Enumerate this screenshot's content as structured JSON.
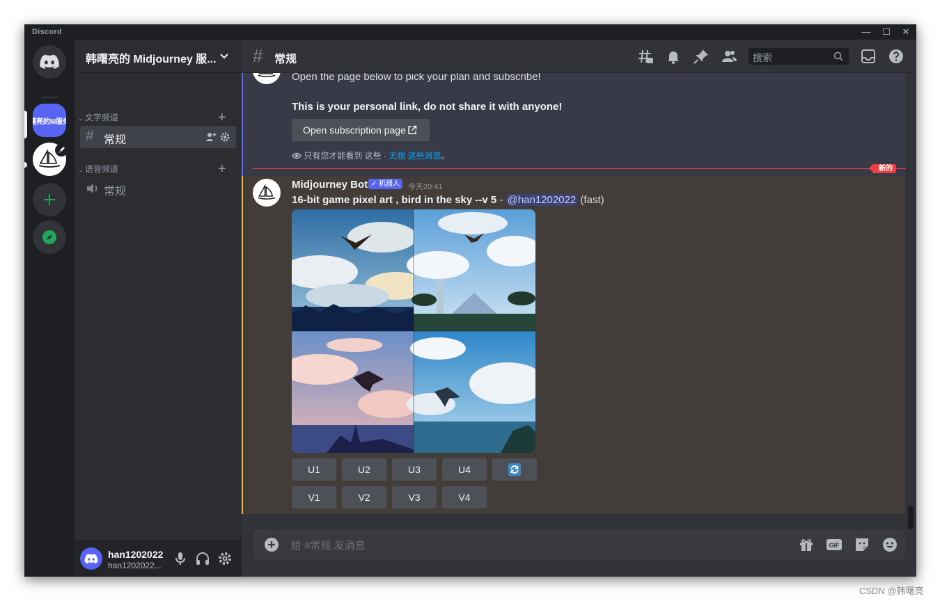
{
  "app": {
    "name": "Discord"
  },
  "window_controls": {
    "minimize": "—",
    "maximize": "☐",
    "close": "✕"
  },
  "servers": {
    "server1_label": "曙亮的M服务"
  },
  "guild": {
    "name": "韩曙亮的 Midjourney 服..."
  },
  "categories": [
    {
      "label": "文字频道",
      "channels": [
        {
          "name": "常规"
        }
      ]
    },
    {
      "label": "语音频道",
      "channels": [
        {
          "name": "常规"
        }
      ]
    }
  ],
  "user": {
    "name": "han1202022",
    "tag": "han1202022..."
  },
  "channel": {
    "name": "常规"
  },
  "search": {
    "placeholder": "搜索"
  },
  "ephemeral": {
    "line1": "Open the page below to pick your plan and subscribe!",
    "line2": "This is your personal link, do not share it with anyone!",
    "button": "Open subscription page",
    "note_prefix": "只有您才能看到 这些 · ",
    "note_link": "无视 这些消息",
    "note_suffix": "。"
  },
  "new_badge": "新的",
  "bot_message": {
    "author": "Midjourney Bot",
    "tag": "✓ 机器人",
    "time": "今天20:41",
    "prompt": "16-bit game pixel art , bird in the sky --v 5",
    "separator": " - ",
    "mention": "@han1202022",
    "mode": " (fast)"
  },
  "buttons_row1": [
    "U1",
    "U2",
    "U3",
    "U4"
  ],
  "buttons_row2": [
    "V1",
    "V2",
    "V3",
    "V4"
  ],
  "composer": {
    "placeholder": "给 #常规 发消息"
  },
  "watermark": "CSDN @韩曙亮",
  "colors": {
    "blurple": "#5865f2",
    "green": "#23a55a",
    "red": "#f23f43",
    "gold": "#f0b232"
  }
}
